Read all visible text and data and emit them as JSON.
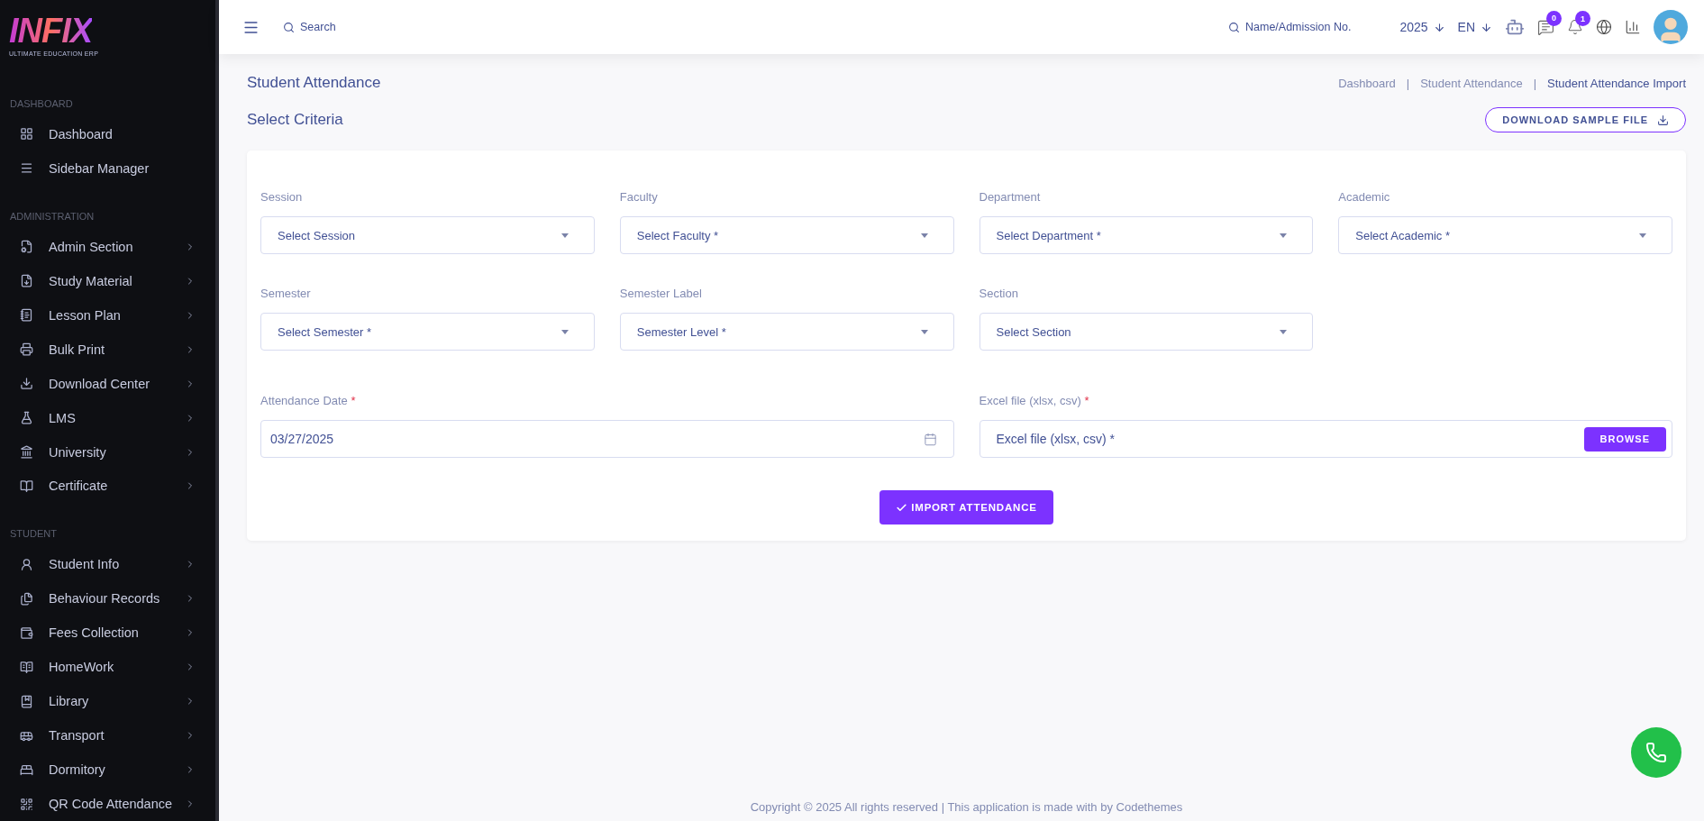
{
  "logo": {
    "wordmark": "INFIX",
    "tagline": "ULTIMATE EDUCATION ERP"
  },
  "sidebar": {
    "sections": [
      {
        "heading": "DASHBOARD",
        "items": [
          {
            "label": "Dashboard",
            "expandable": false
          },
          {
            "label": "Sidebar Manager",
            "expandable": false
          }
        ]
      },
      {
        "heading": "ADMINISTRATION",
        "items": [
          {
            "label": "Admin Section",
            "expandable": true
          },
          {
            "label": "Study Material",
            "expandable": true
          },
          {
            "label": "Lesson Plan",
            "expandable": true
          },
          {
            "label": "Bulk Print",
            "expandable": true
          },
          {
            "label": "Download Center",
            "expandable": true
          },
          {
            "label": "LMS",
            "expandable": true
          },
          {
            "label": "University",
            "expandable": true
          },
          {
            "label": "Certificate",
            "expandable": true
          }
        ]
      },
      {
        "heading": "STUDENT",
        "items": [
          {
            "label": "Student Info",
            "expandable": true
          },
          {
            "label": "Behaviour Records",
            "expandable": true
          },
          {
            "label": "Fees Collection",
            "expandable": true
          },
          {
            "label": "HomeWork",
            "expandable": true
          },
          {
            "label": "Library",
            "expandable": true
          },
          {
            "label": "Transport",
            "expandable": true
          },
          {
            "label": "Dormitory",
            "expandable": true
          },
          {
            "label": "QR Code Attendance",
            "expandable": true
          }
        ]
      }
    ]
  },
  "topbar": {
    "search": "Search",
    "student_search": "Name/Admission No.",
    "year": "2025",
    "language": "EN",
    "messages_badge": "0",
    "notifications_badge": "1"
  },
  "page": {
    "title": "Student Attendance",
    "breadcrumb_separator": "|",
    "breadcrumbs": [
      {
        "label": "Dashboard",
        "current": false
      },
      {
        "label": "Student Attendance",
        "current": false
      },
      {
        "label": "Student Attendance Import",
        "current": true
      }
    ],
    "subtitle": "Select Criteria",
    "download_button": "DOWNLOAD SAMPLE FILE"
  },
  "form": {
    "fields": [
      {
        "kind": "select",
        "label": "Session",
        "required": false,
        "placeholder": "Select Session"
      },
      {
        "kind": "select",
        "label": "Faculty",
        "required": false,
        "placeholder": "Select Faculty *"
      },
      {
        "kind": "select",
        "label": "Department",
        "required": false,
        "placeholder": "Select Department *"
      },
      {
        "kind": "select",
        "label": "Academic",
        "required": false,
        "placeholder": "Select Academic *"
      },
      {
        "kind": "select",
        "label": "Semester",
        "required": false,
        "placeholder": "Select Semester *"
      },
      {
        "kind": "select",
        "label": "Semester Label",
        "required": false,
        "placeholder": "Semester Level *"
      },
      {
        "kind": "select",
        "label": "Section",
        "required": false,
        "placeholder": "Select Section"
      },
      {
        "kind": "date",
        "label": "Attendance Date",
        "required": true,
        "value": "03/27/2025"
      },
      {
        "kind": "file",
        "label": "Excel file (xlsx, csv)",
        "required": true,
        "placeholder": "Excel file (xlsx, csv) *",
        "button": "BROWSE"
      }
    ],
    "required_mark": "*",
    "submit": "IMPORT ATTENDANCE"
  },
  "footer": "Copyright © 2025 All rights reserved | This application is made with by Codethemes"
}
